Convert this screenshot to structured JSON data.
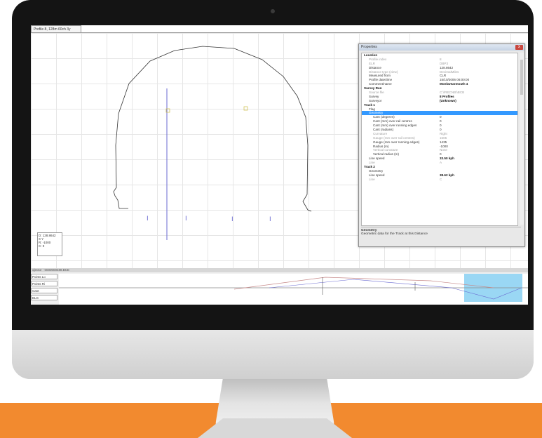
{
  "colors": {
    "band": "#f28a2f",
    "selection": "#3399ff",
    "highlight": "#8fd3f3",
    "profile_line": "#333333",
    "axis_line": "#6a6ad1"
  },
  "tab": {
    "title": "Profile 8, 128m 60ch 3y"
  },
  "legend": {
    "line1": "D: 128.8642",
    "line2": "X        Y",
    "line3": "R: -1000",
    "line4": "C: 0"
  },
  "props": {
    "title": "Properties",
    "close": "x",
    "rows": [
      {
        "k": "Location",
        "v": "",
        "type": "cat"
      },
      {
        "k": "Profile index",
        "v": "8",
        "type": "muted"
      },
      {
        "k": "ELR",
        "v": "DBP3",
        "type": "muted"
      },
      {
        "k": "Distance",
        "v": "128.8642",
        "type": ""
      },
      {
        "k": "Distance type (view)",
        "v": "DecimalMiles",
        "type": "muted"
      },
      {
        "k": "Measured from",
        "v": "CLR",
        "type": ""
      },
      {
        "k": "Profile date/time",
        "v": "15/10/2006 06:00:00",
        "type": ""
      },
      {
        "k": "Comment/name",
        "v": "Monkwearmouth 4",
        "type": "strong"
      },
      {
        "k": "Survey Run",
        "v": "",
        "type": "cat"
      },
      {
        "k": "Source file",
        "v": "C:\\\\RECNB\\\\BCB",
        "type": "muted"
      },
      {
        "k": "Survey",
        "v": "8 Profiles",
        "type": "strong"
      },
      {
        "k": "Surveyor",
        "v": "(Unknown)",
        "type": "strong"
      },
      {
        "k": "Track 1",
        "v": "",
        "type": "cat"
      },
      {
        "k": "Flag",
        "v": "",
        "type": ""
      },
      {
        "k": "Geometry",
        "v": "",
        "type": "sel"
      },
      {
        "k": "Cant (degrees)",
        "v": "0",
        "type": "sub"
      },
      {
        "k": "Cant (mm) over rail centres",
        "v": "0",
        "type": "sub"
      },
      {
        "k": "Cant (mm) over running edges",
        "v": "0",
        "type": "sub"
      },
      {
        "k": "Cant (radians)",
        "v": "0",
        "type": "sub"
      },
      {
        "k": "Curvature",
        "v": "Right",
        "type": "sub muted"
      },
      {
        "k": "Gauge (mm over rail centres)",
        "v": "1505",
        "type": "sub muted"
      },
      {
        "k": "Gauge (mm over running edges)",
        "v": "1435",
        "type": "sub"
      },
      {
        "k": "Radius (m)",
        "v": "-1000",
        "type": "sub"
      },
      {
        "k": "Vertical curvature",
        "v": "None",
        "type": "sub muted"
      },
      {
        "k": "Vertical radius (m)",
        "v": "0",
        "type": "sub"
      },
      {
        "k": "Line speed",
        "v": "33.50 kph",
        "type": "strong"
      },
      {
        "k": "Line",
        "v": "A",
        "type": "muted"
      },
      {
        "k": "Track 2",
        "v": "",
        "type": "cat"
      },
      {
        "k": "Geometry",
        "v": "",
        "type": ""
      },
      {
        "k": "Line speed",
        "v": "38.62 kph",
        "type": "strong"
      },
      {
        "k": "Line",
        "v": "C",
        "type": "muted"
      }
    ],
    "desc_title": "Geometry",
    "desc_text": "Geometric data for the Track at this Distance"
  },
  "bottom": {
    "title": "ojector - 0000000488.BCE",
    "labels": [
      "Points Lo",
      "Points Ri",
      "Cant",
      "ELG"
    ]
  }
}
